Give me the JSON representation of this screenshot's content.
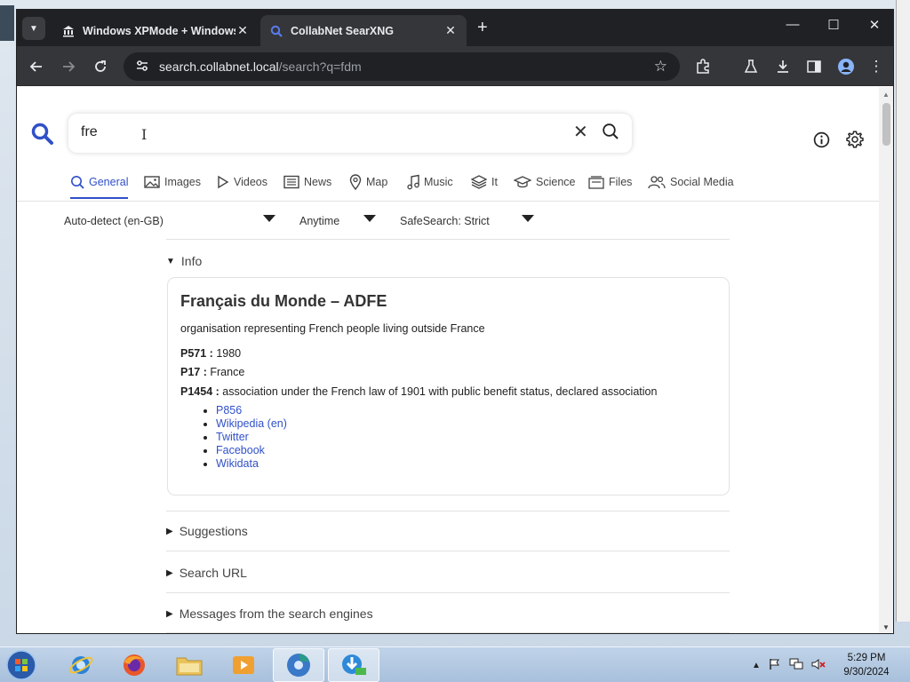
{
  "browser": {
    "tabs": [
      {
        "title": "Windows XPMode + Windows",
        "icon": "bank-icon"
      },
      {
        "title": "CollabNet SearXNG",
        "icon": "search-icon",
        "active": true
      }
    ],
    "url_host": "search.collabnet.local",
    "url_path": "/search?q=fdm"
  },
  "search": {
    "query": "fre",
    "categories": [
      "General",
      "Images",
      "Videos",
      "News",
      "Map",
      "Music",
      "It",
      "Science",
      "Files",
      "Social Media"
    ],
    "active_category": "General",
    "filters": {
      "language": "Auto-detect (en-GB)",
      "time": "Anytime",
      "safesearch": "SafeSearch: Strict"
    }
  },
  "sections": {
    "info": "Info",
    "suggestions": "Suggestions",
    "search_url": "Search URL",
    "messages": "Messages from the search engines"
  },
  "infobox": {
    "title": "Français du Monde – ADFE",
    "description": "organisation representing French people living outside France",
    "attributes": [
      {
        "key": "P571 :",
        "value": " 1980"
      },
      {
        "key": "P17 :",
        "value": " France"
      },
      {
        "key": "P1454 :",
        "value": " association under the French law of 1901 with public benefit status, declared association"
      }
    ],
    "links": [
      "P856",
      "Wikipedia (en)",
      "Twitter",
      "Facebook",
      "Wikidata"
    ]
  },
  "taskbar": {
    "time": "5:29 PM",
    "date": "9/30/2024",
    "apps": [
      "ie-icon",
      "firefox-icon",
      "explorer-icon",
      "media-player-icon",
      "chromium-icon",
      "download-manager-icon"
    ]
  },
  "colors": {
    "accent": "#3050c8",
    "chrome_dark": "#202124",
    "chrome_toolbar": "#35363a"
  }
}
